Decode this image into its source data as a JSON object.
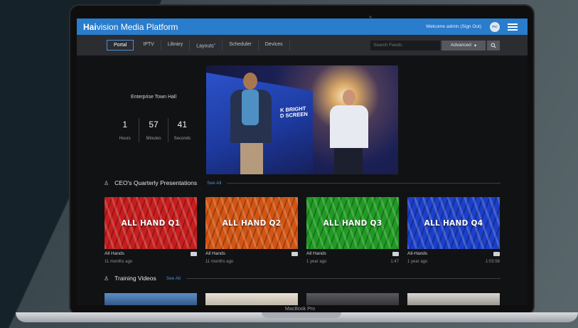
{
  "header": {
    "logo_bold": "Hai",
    "logo_rest": "vision Media Platform",
    "welcome": "Welcome admin",
    "sign_out": "(Sign Out)",
    "avatar": "PIC"
  },
  "nav": {
    "tabs": [
      {
        "label": "Portal",
        "active": true
      },
      {
        "label": "IPTV"
      },
      {
        "label": "Library"
      },
      {
        "label": "Layouts"
      },
      {
        "label": "Scheduler"
      },
      {
        "label": "Devices"
      }
    ],
    "search_placeholder": "Search Feeds",
    "advanced_label": "Advanced"
  },
  "live_event": {
    "title": "Enterprise Town Hall",
    "hours": "1",
    "hours_label": "Hours",
    "minutes": "57",
    "minutes_label": "Minutes",
    "seconds": "41",
    "seconds_label": "Seconds",
    "screen_text_line1": "K BRIGHT",
    "screen_text_line2": "D SCREEN"
  },
  "sections": [
    {
      "title": "CEO's Quarterly Presentations",
      "see_all": "See All"
    },
    {
      "title": "Training Videos",
      "see_all": "See All"
    }
  ],
  "videos": [
    {
      "label": "ALL HAND Q1",
      "category": "All Hands",
      "age": "11 months ago",
      "duration": "",
      "color": "#c81d1d"
    },
    {
      "label": "ALL HAND Q2",
      "category": "All Hands",
      "age": "11 months ago",
      "duration": "",
      "color": "#d35412"
    },
    {
      "label": "ALL HAND Q3",
      "category": "All Hands",
      "age": "1 year ago",
      "duration": "1:47",
      "color": "#1f9a22"
    },
    {
      "label": "ALL HAND Q4",
      "category": "All-Hands",
      "age": "1 year ago",
      "duration": "1:03:56",
      "color": "#1b3fc8"
    }
  ],
  "device": {
    "name": "MacBook Pro"
  },
  "colors": {
    "brand_blue": "#2a7ccc",
    "link_blue": "#4d8fd6"
  }
}
